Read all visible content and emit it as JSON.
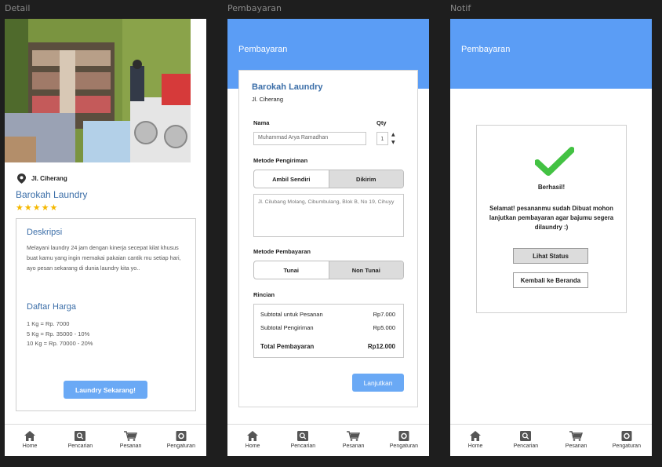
{
  "frames": {
    "detail_label": "Detail",
    "payment_label": "Pembayaran",
    "notif_label": "Notif"
  },
  "nav": {
    "items": [
      {
        "label": "Home",
        "icon": "home-icon"
      },
      {
        "label": "Pencarian",
        "icon": "search-icon"
      },
      {
        "label": "Pesanan",
        "icon": "cart-icon"
      },
      {
        "label": "Pengaturan",
        "icon": "settings-icon"
      }
    ]
  },
  "detail": {
    "location": "Jl. Ciherang",
    "store_name": "Barokah Laundry",
    "rating": 5,
    "description_title": "Deskripsi",
    "description": "Melayani laundry 24 jam dengan kinerja secepat kilat khusus buat kamu yang ingin memakai pakaian cantik mu setiap hari, ayo pesan sekarang di dunia laundry kita yo..",
    "price_title": "Daftar Harga",
    "prices": [
      "1 Kg = Rp. 7000",
      "5 Kg = Rp. 35000 - 10%",
      "10 Kg =  Rp. 70000 - 20%"
    ],
    "cta_button": "Laundry Sekarang!"
  },
  "payment": {
    "header_title": "Pembayaran",
    "store_name": "Barokah Laundry",
    "store_address": "Jl. Ciherang",
    "name_label": "Nama",
    "name_value": "Muhammad Arya Ramadhan",
    "qty_label": "Qty",
    "qty_value": "1",
    "shipping_label": "Metode Pengiriman",
    "shipping_options": [
      "Ambil Sendiri",
      "Dikirim"
    ],
    "shipping_selected": "Dikirim",
    "address_value": "Jl. Cilubang Molang, Cibumbulang, Blok B, No 19, Cihuyy",
    "payment_label": "Metode Pembayaran",
    "payment_options": [
      "Tunai",
      "Non Tunai"
    ],
    "payment_selected": "Non Tunai",
    "rincian_label": "Rincian",
    "subtotal_order_label": "Subtotal untuk Pesanan",
    "subtotal_order_value": "Rp7.000",
    "subtotal_shipping_label": "Subtotal Pengiriman",
    "subtotal_shipping_value": "Rp5.000",
    "total_label": "Total Pembayaran",
    "total_value": "Rp12.000",
    "continue_button": "Lanjutkan",
    "accent_color": "#5b9df5"
  },
  "notif": {
    "header_title": "Pembayaran",
    "success_title": "Berhasil!",
    "success_message": "Selamat! pesananmu sudah Dibuat mohon lanjutkan pembayaran agar bajumu segera dilaundry :)",
    "status_button": "Lihat Status",
    "home_button": "Kembali ke Beranda",
    "check_color": "#3fbf3f"
  }
}
